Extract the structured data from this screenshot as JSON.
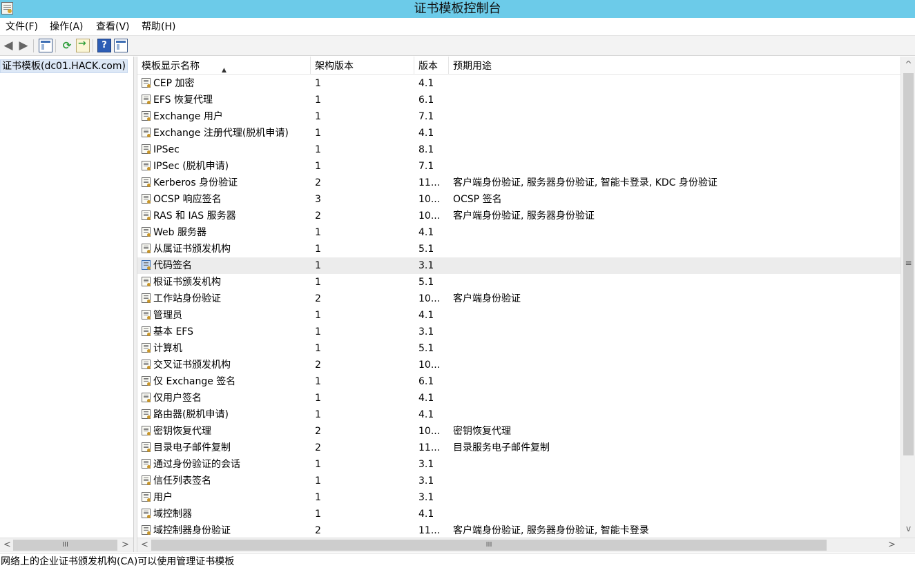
{
  "window": {
    "title": "证书模板控制台"
  },
  "menu": {
    "items": [
      "文件(F)",
      "操作(A)",
      "查看(V)",
      "帮助(H)"
    ]
  },
  "toolbar": {
    "back_icon": "back-arrow-icon",
    "forward_icon": "forward-arrow-icon",
    "show_hide_tree_icon": "console-tree-icon",
    "refresh_icon": "refresh-icon",
    "export_icon": "export-list-icon",
    "help_icon": "help-icon",
    "help_glyph": "?",
    "action_pane_icon": "action-pane-icon"
  },
  "tree": {
    "root_label": "证书模板(dc01.HACK.com)"
  },
  "list": {
    "columns": [
      "模板显示名称",
      "架构版本",
      "版本",
      "预期用途"
    ],
    "sort_column": 0,
    "sort_direction": "ascending",
    "selected_index": 11,
    "rows": [
      {
        "name": "CEP 加密",
        "schema": "1",
        "version": "4.1",
        "purpose": ""
      },
      {
        "name": "EFS 恢复代理",
        "schema": "1",
        "version": "6.1",
        "purpose": ""
      },
      {
        "name": "Exchange 用户",
        "schema": "1",
        "version": "7.1",
        "purpose": ""
      },
      {
        "name": "Exchange 注册代理(脱机申请)",
        "schema": "1",
        "version": "4.1",
        "purpose": ""
      },
      {
        "name": "IPSec",
        "schema": "1",
        "version": "8.1",
        "purpose": ""
      },
      {
        "name": "IPSec (脱机申请)",
        "schema": "1",
        "version": "7.1",
        "purpose": ""
      },
      {
        "name": "Kerberos 身份验证",
        "schema": "2",
        "version": "11...",
        "purpose": "客户端身份验证, 服务器身份验证, 智能卡登录, KDC 身份验证"
      },
      {
        "name": "OCSP 响应签名",
        "schema": "3",
        "version": "10...",
        "purpose": "OCSP 签名"
      },
      {
        "name": "RAS 和 IAS 服务器",
        "schema": "2",
        "version": "10...",
        "purpose": "客户端身份验证, 服务器身份验证"
      },
      {
        "name": "Web 服务器",
        "schema": "1",
        "version": "4.1",
        "purpose": ""
      },
      {
        "name": "从属证书颁发机构",
        "schema": "1",
        "version": "5.1",
        "purpose": ""
      },
      {
        "name": "代码签名",
        "schema": "1",
        "version": "3.1",
        "purpose": ""
      },
      {
        "name": "根证书颁发机构",
        "schema": "1",
        "version": "5.1",
        "purpose": ""
      },
      {
        "name": "工作站身份验证",
        "schema": "2",
        "version": "10...",
        "purpose": "客户端身份验证"
      },
      {
        "name": "管理员",
        "schema": "1",
        "version": "4.1",
        "purpose": ""
      },
      {
        "name": "基本 EFS",
        "schema": "1",
        "version": "3.1",
        "purpose": ""
      },
      {
        "name": "计算机",
        "schema": "1",
        "version": "5.1",
        "purpose": ""
      },
      {
        "name": "交叉证书颁发机构",
        "schema": "2",
        "version": "10...",
        "purpose": ""
      },
      {
        "name": "仅 Exchange 签名",
        "schema": "1",
        "version": "6.1",
        "purpose": ""
      },
      {
        "name": "仅用户签名",
        "schema": "1",
        "version": "4.1",
        "purpose": ""
      },
      {
        "name": "路由器(脱机申请)",
        "schema": "1",
        "version": "4.1",
        "purpose": ""
      },
      {
        "name": "密钥恢复代理",
        "schema": "2",
        "version": "10...",
        "purpose": "密钥恢复代理"
      },
      {
        "name": "目录电子邮件复制",
        "schema": "2",
        "version": "11...",
        "purpose": "目录服务电子邮件复制"
      },
      {
        "name": "通过身份验证的会话",
        "schema": "1",
        "version": "3.1",
        "purpose": ""
      },
      {
        "name": "信任列表签名",
        "schema": "1",
        "version": "3.1",
        "purpose": ""
      },
      {
        "name": "用户",
        "schema": "1",
        "version": "3.1",
        "purpose": ""
      },
      {
        "name": "域控制器",
        "schema": "1",
        "version": "4.1",
        "purpose": ""
      },
      {
        "name": "域控制器身份验证",
        "schema": "2",
        "version": "11...",
        "purpose": "客户端身份验证, 服务器身份验证, 智能卡登录"
      }
    ]
  },
  "scroll": {
    "vertical_position": 0.0,
    "left_arrow": "<",
    "right_arrow": ">",
    "up_arrow": "^",
    "down_arrow": "v",
    "grip": "III",
    "vgrip": "≡"
  },
  "status": {
    "text": "网络上的企业证书颁发机构(CA)可以使用管理证书模板"
  }
}
